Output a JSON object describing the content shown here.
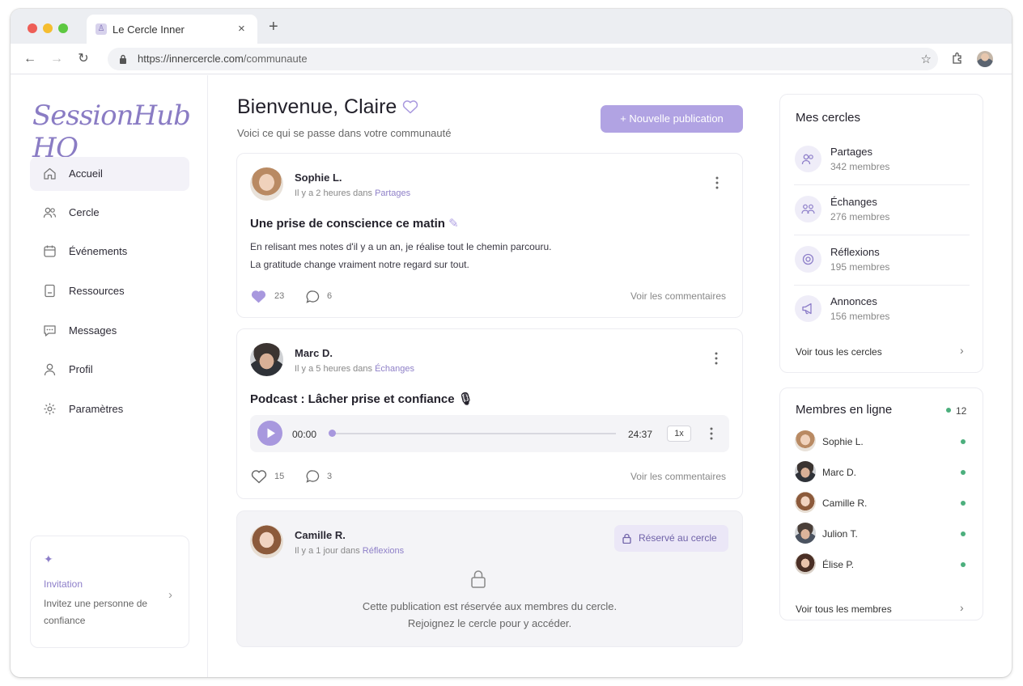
{
  "browser": {
    "tab_title": "Le Cercle Inner",
    "url_host": "https://innercercle.com",
    "url_path": "/communaute"
  },
  "sidebar": {
    "logo": "SessionHub HQ",
    "items": [
      {
        "label": "Accueil",
        "icon": "home-icon",
        "active": true
      },
      {
        "label": "Cercle",
        "icon": "users-icon"
      },
      {
        "label": "Événements",
        "icon": "calendar-icon"
      },
      {
        "label": "Ressources",
        "icon": "book-icon"
      },
      {
        "label": "Messages",
        "icon": "chat-icon"
      },
      {
        "label": "Profil",
        "icon": "user-icon"
      },
      {
        "label": "Paramètres",
        "icon": "gear-icon"
      }
    ],
    "invite": {
      "title": "Invitation",
      "text": "Invitez une personne de confiance"
    }
  },
  "main": {
    "title": "Bienvenue, Claire",
    "subtitle": "Voici ce qui se passe dans votre communauté",
    "new_post_label": "+  Nouvelle publication"
  },
  "posts": [
    {
      "author": "Sophie L.",
      "time": "Il y a 2 heures dans",
      "circle": "Partages",
      "title": "Une prise de conscience ce matin",
      "body": [
        "En relisant mes notes d'il y a un an, je réalise tout le chemin parcouru.",
        "La gratitude change vraiment notre regard sur tout."
      ],
      "likes": "23",
      "comments": "6",
      "liked": true,
      "comments_link": "Voir les commentaires"
    },
    {
      "author": "Marc D.",
      "time": "Il y a 5 heures dans",
      "circle": "Échanges",
      "title": "Podcast : Lâcher prise et confiance 🎙",
      "audio": {
        "current": "00:00",
        "duration": "24:37",
        "speed": "1x",
        "progress": 0
      },
      "likes": "15",
      "comments": "3",
      "liked": false,
      "comments_link": "Voir les commentaires"
    },
    {
      "author": "Camille R.",
      "time": "Il y a 1 jour dans",
      "circle": "Réflexions",
      "badge": "Réservé au cercle",
      "locked_line1": "Cette publication est réservée aux membres du cercle.",
      "locked_line2": "Rejoignez le cercle pour y accéder."
    }
  ],
  "circles": {
    "title": "Mes cercles",
    "items": [
      {
        "name": "Partages",
        "members": "342 membres",
        "icon": "users-icon"
      },
      {
        "name": "Échanges",
        "members": "276 membres",
        "icon": "group-icon"
      },
      {
        "name": "Réflexions",
        "members": "195 membres",
        "icon": "target-icon"
      },
      {
        "name": "Annonces",
        "members": "156 membres",
        "icon": "megaphone-icon"
      }
    ],
    "link": "Voir tous les cercles"
  },
  "online": {
    "title": "Membres en ligne",
    "count": "12",
    "members": [
      "Sophie L.",
      "Marc D.",
      "Camille R.",
      "Julion T.",
      "Élise P."
    ],
    "link": "Voir tous les membres"
  },
  "colors": {
    "accent": "#b1a3e3",
    "accent_dark": "#8d7ec9",
    "online": "#4caf7d"
  }
}
